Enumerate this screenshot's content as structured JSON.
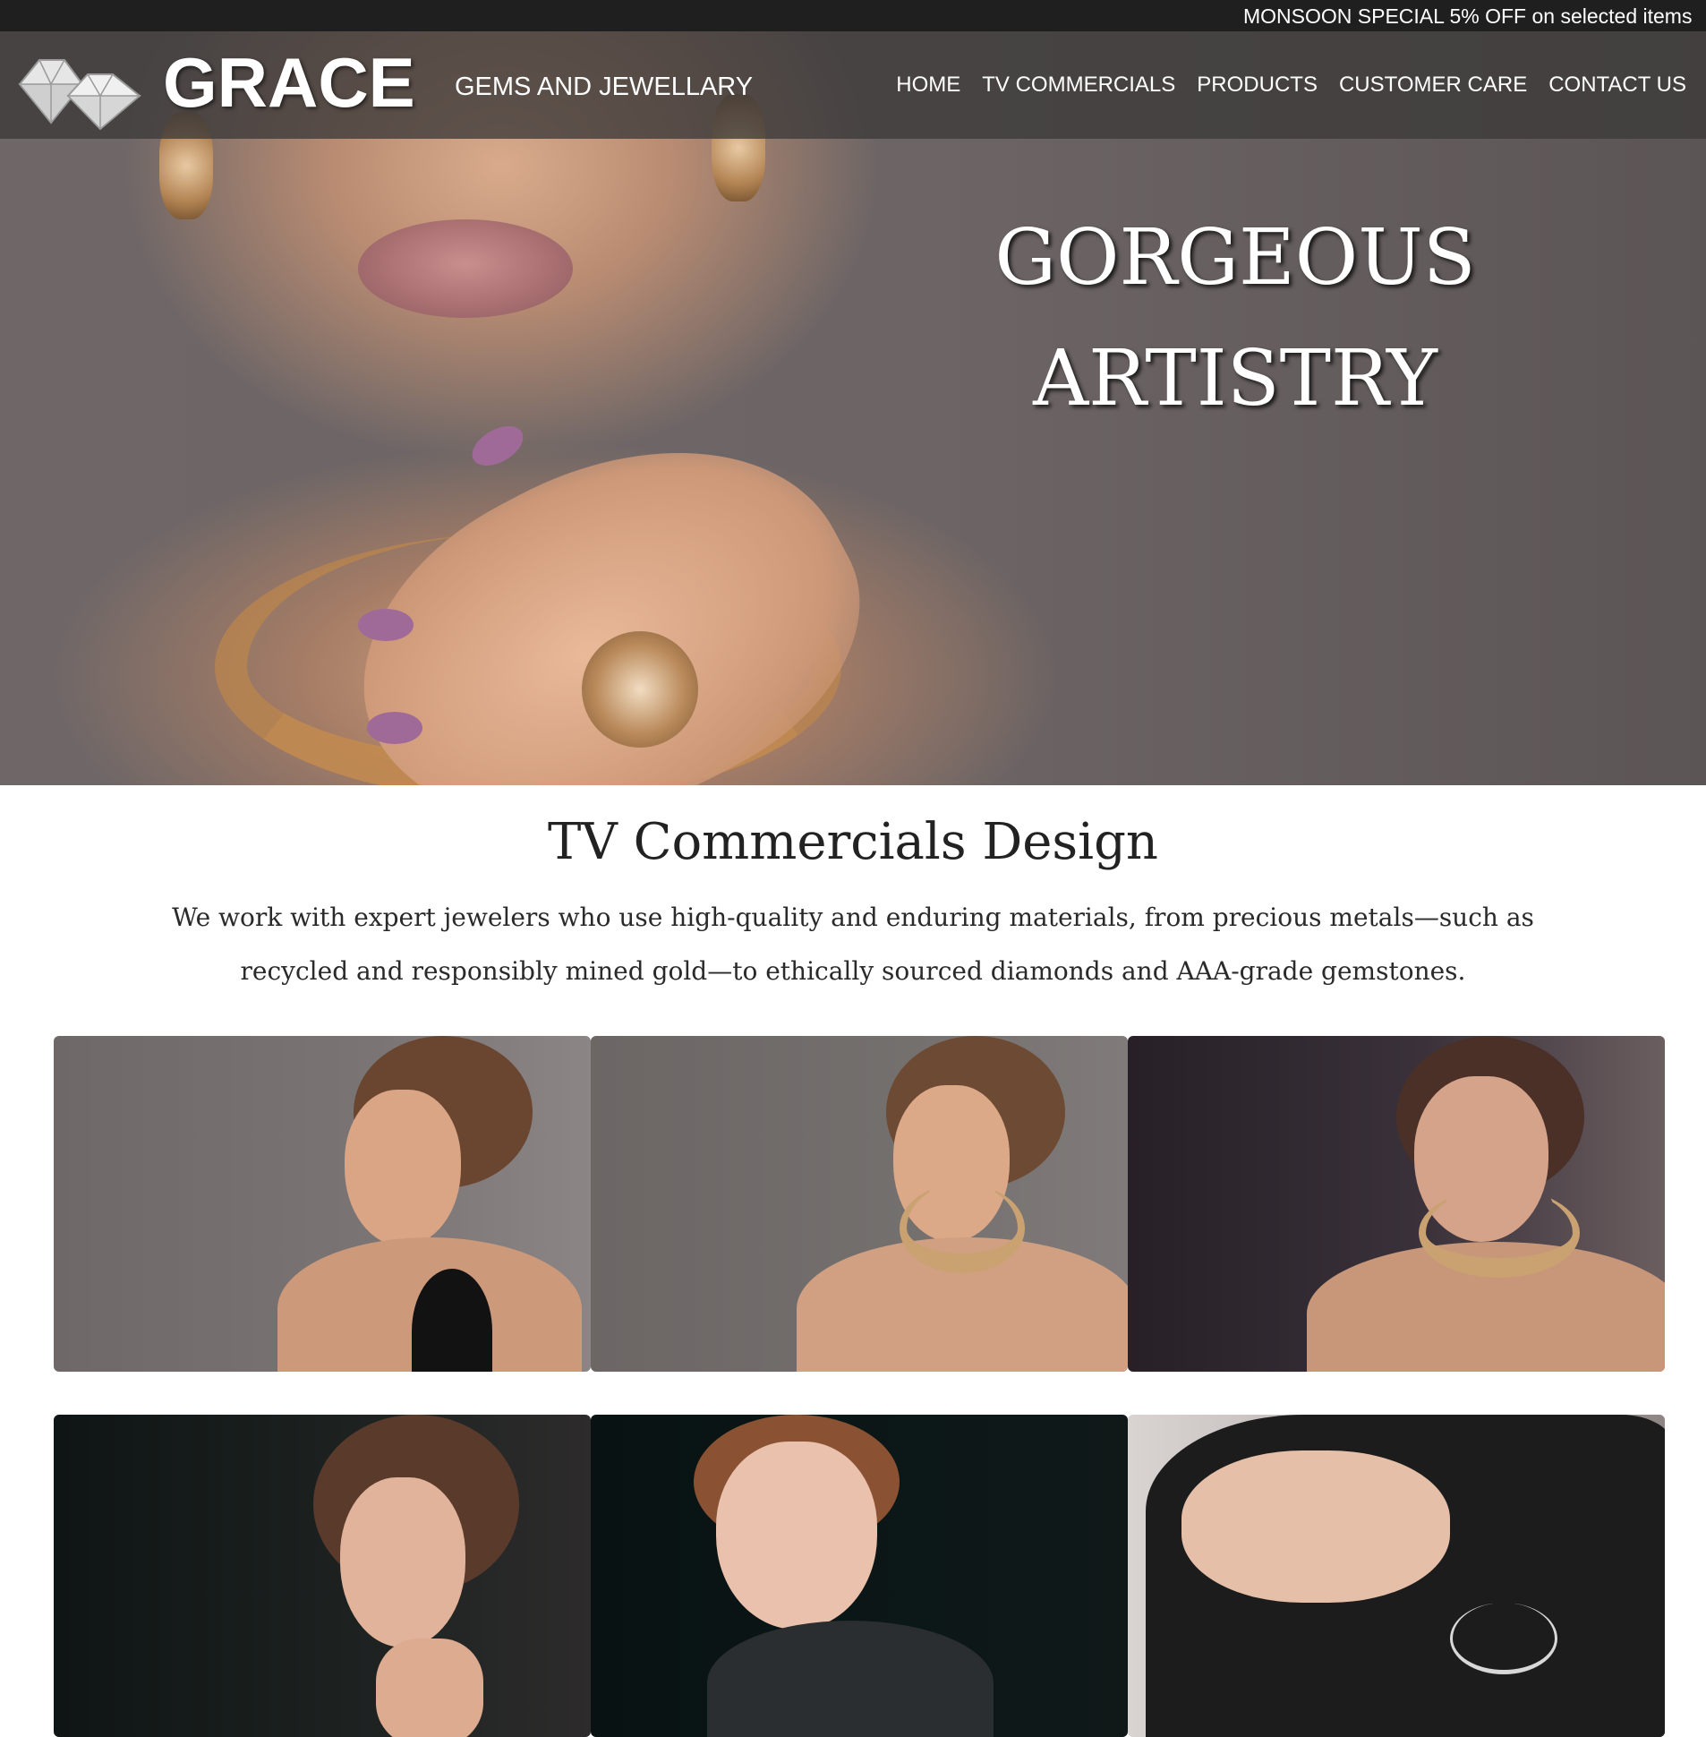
{
  "promo": {
    "text": "MONSOON SPECIAL 5% OFF on selected items"
  },
  "header": {
    "brand_name": "GRACE",
    "tagline": "GEMS AND JEWELLARY",
    "logo_icon": "diamond-icon",
    "nav": [
      {
        "label": "HOME"
      },
      {
        "label": "TV COMMERCIALS"
      },
      {
        "label": "PRODUCTS"
      },
      {
        "label": "CUSTOMER CARE"
      },
      {
        "label": "CONTACT US"
      }
    ]
  },
  "hero": {
    "line1": "GORGEOUS",
    "line2": "ARTISTRY"
  },
  "section": {
    "title": "TV Commercials Design",
    "description": "We work with expert jewelers who use high-quality and enduring materials, from precious metals—such as recycled and responsibly mined gold—to ethically sourced diamonds and AAA-grade gemstones."
  },
  "colors": {
    "promo_bg": "#1f1f1f",
    "header_overlay": "#3c3a3a",
    "text_dark": "#222222",
    "white": "#ffffff"
  }
}
